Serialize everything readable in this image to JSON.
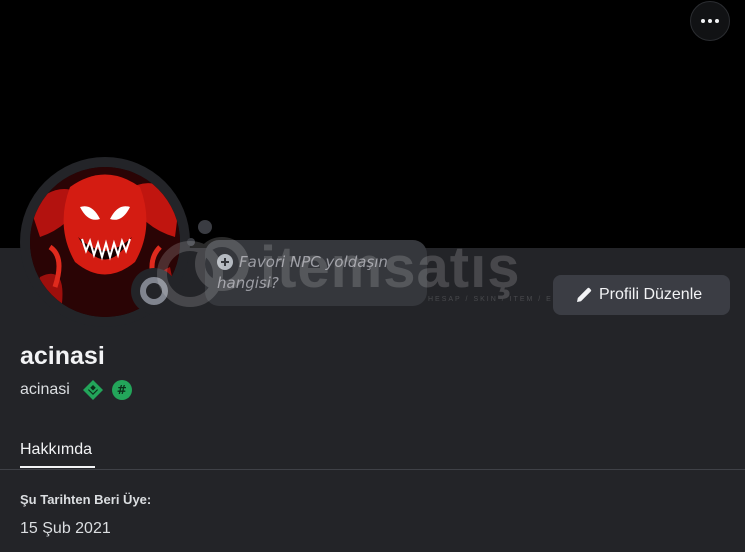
{
  "profile": {
    "display_name": "acinasi",
    "username": "acinasi",
    "status_placeholder": "Favori NPC yoldaşın hangisi?",
    "edit_button_label": "Profili Düzenle",
    "badges": [
      "nitro-diamond-icon",
      "hashtag-badge-icon"
    ],
    "presence": "offline"
  },
  "tabs": [
    {
      "label": "Hakkımda",
      "active": true
    }
  ],
  "about": {
    "member_since_label": "Şu Tarihten Beri Üye:",
    "member_since_value": "15 Şub 2021"
  },
  "watermark": {
    "text": "itemsatış",
    "subtext": "HESAP / SKIN / ITEM / E-PIN"
  },
  "colors": {
    "banner": "#000000",
    "panel": "#232428",
    "button": "#3b3d44",
    "badge_green": "#23a55a",
    "offline_gray": "#80848e"
  }
}
